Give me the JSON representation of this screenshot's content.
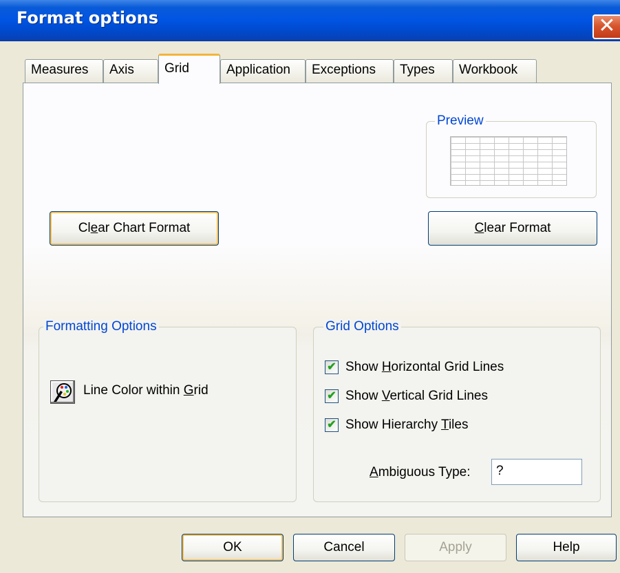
{
  "window": {
    "title": "Format options",
    "close_glyph": "✕"
  },
  "tabs": [
    {
      "label": "Measures",
      "active": false
    },
    {
      "label": "Axis",
      "active": false
    },
    {
      "label": "Grid",
      "active": true
    },
    {
      "label": "Application",
      "active": false
    },
    {
      "label": "Exceptions",
      "active": false
    },
    {
      "label": "Types",
      "active": false
    },
    {
      "label": "Workbook",
      "active": false
    }
  ],
  "preview": {
    "title": "Preview"
  },
  "buttons": {
    "clear_chart_format": {
      "pre": "Cl",
      "mn": "e",
      "post": "ar Chart Format"
    },
    "clear_format": {
      "pre": "",
      "mn": "C",
      "post": "lear Format"
    }
  },
  "formatting_options": {
    "title": "Formatting Options",
    "line_color": {
      "pre": "Line Color within ",
      "mn": "G",
      "post": "rid",
      "icon": "color-palette-icon"
    }
  },
  "grid_options": {
    "title": "Grid Options",
    "checkboxes": [
      {
        "pre": "Show ",
        "mn": "H",
        "post": "orizontal Grid Lines",
        "checked": true
      },
      {
        "pre": "Show ",
        "mn": "V",
        "post": "ertical Grid Lines",
        "checked": true
      },
      {
        "pre": "Show Hierarchy ",
        "mn": "T",
        "post": "iles",
        "checked": true
      }
    ],
    "ambiguous_type": {
      "pre": "",
      "mn": "A",
      "post": "mbiguous Type:",
      "value": "?"
    }
  },
  "footer": {
    "ok": "OK",
    "cancel": "Cancel",
    "apply": "Apply",
    "help": "Help"
  },
  "check_glyph": "✔",
  "colors": {
    "title_bar": "#0054e3",
    "group_title": "#0046d5",
    "active_tab_accent": "#f3b43b",
    "checkmark": "#21a121"
  }
}
